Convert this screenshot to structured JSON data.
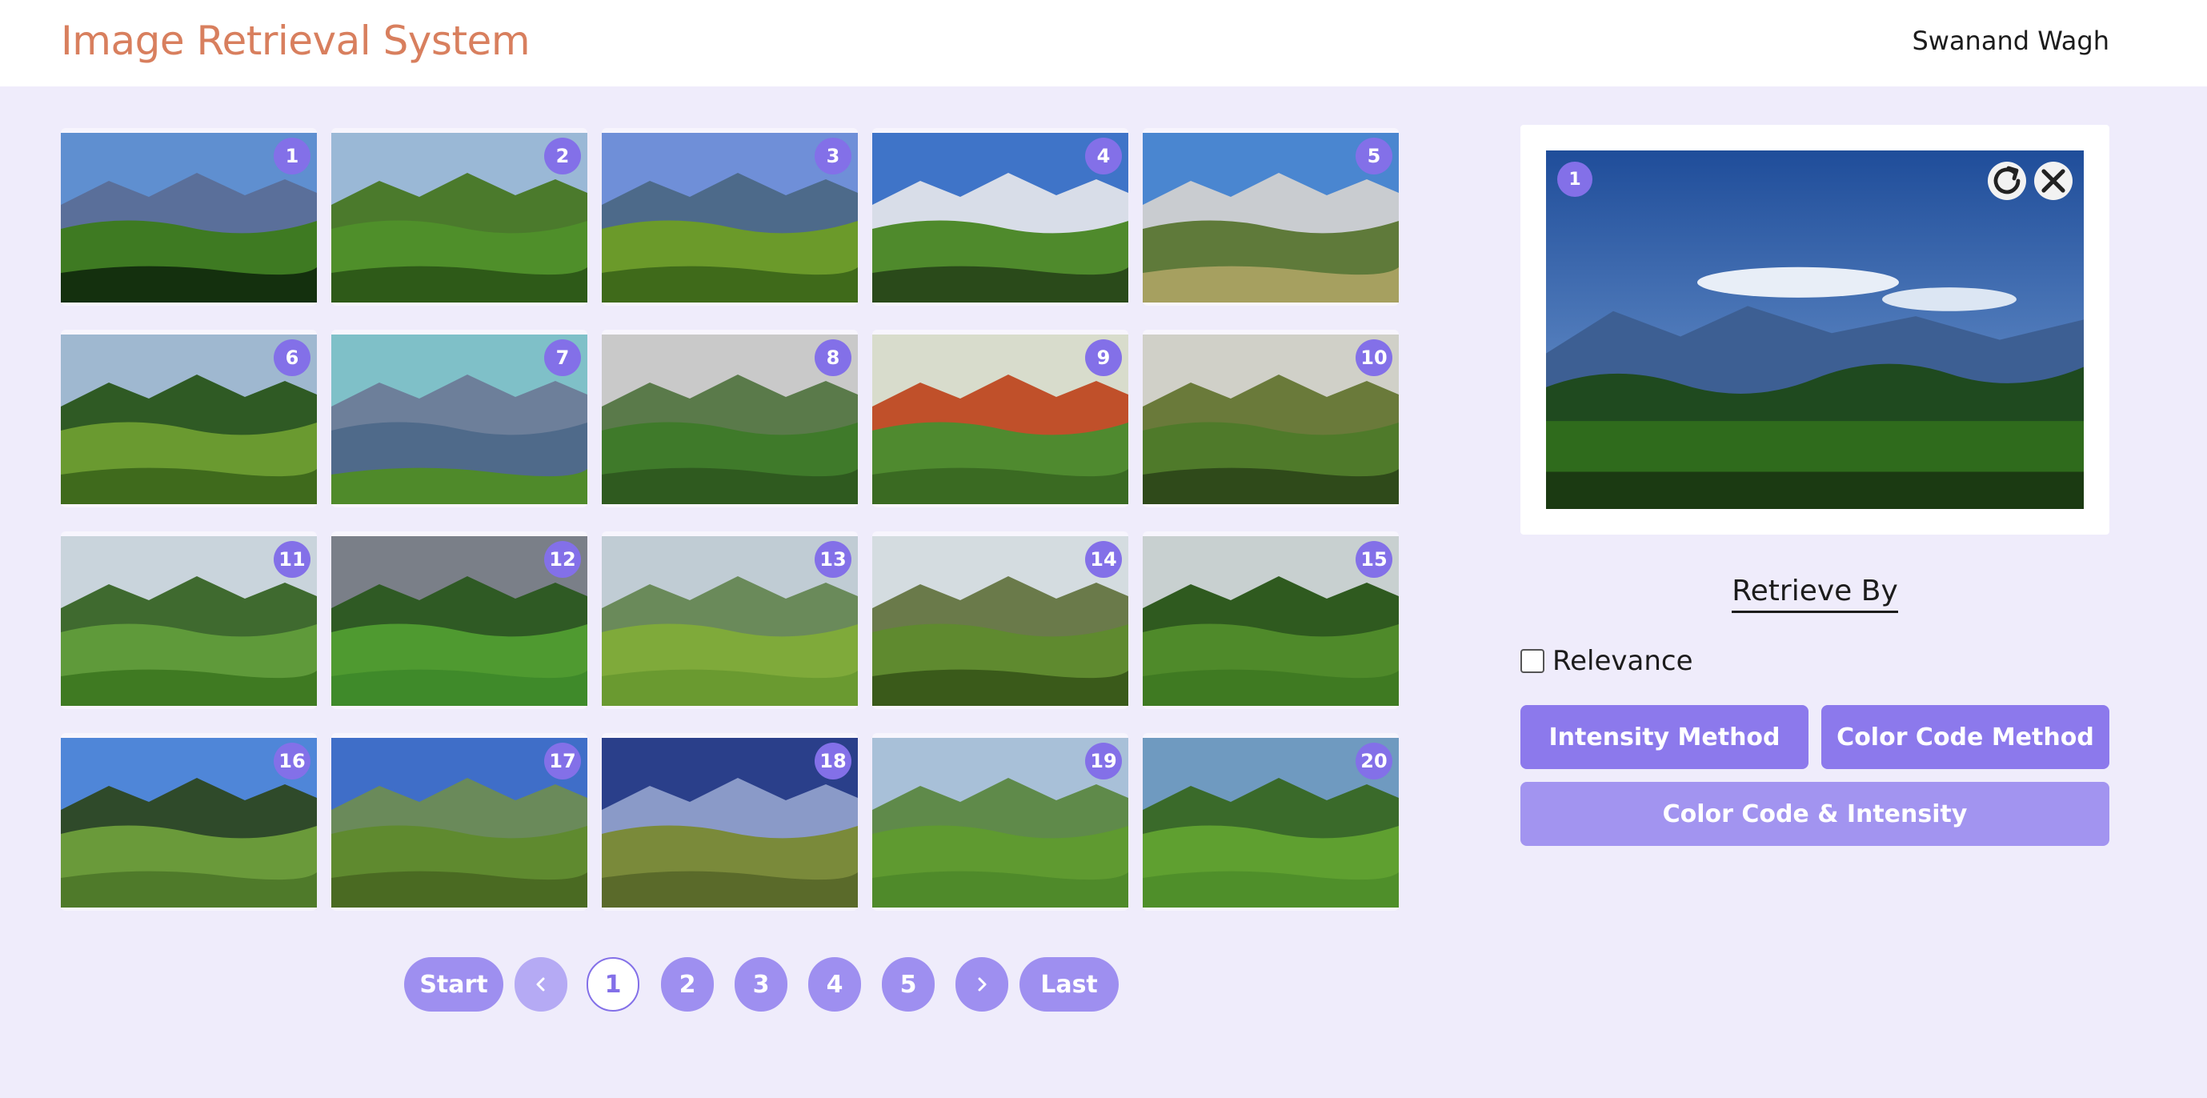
{
  "header": {
    "title": "Image Retrieval System",
    "user": "Swanand Wagh"
  },
  "gallery": {
    "images": [
      {
        "label": "1"
      },
      {
        "label": "2"
      },
      {
        "label": "3"
      },
      {
        "label": "4"
      },
      {
        "label": "5"
      },
      {
        "label": "6"
      },
      {
        "label": "7"
      },
      {
        "label": "8"
      },
      {
        "label": "9"
      },
      {
        "label": "10"
      },
      {
        "label": "11"
      },
      {
        "label": "12"
      },
      {
        "label": "13"
      },
      {
        "label": "14"
      },
      {
        "label": "15"
      },
      {
        "label": "16"
      },
      {
        "label": "17"
      },
      {
        "label": "18"
      },
      {
        "label": "19"
      },
      {
        "label": "20"
      }
    ]
  },
  "pagination": {
    "start": "Start",
    "prev_icon": "chevron-left-icon",
    "pages": [
      "1",
      "2",
      "3",
      "4",
      "5"
    ],
    "current": "1",
    "next_icon": "chevron-right-icon",
    "last": "Last"
  },
  "preview": {
    "label": "1",
    "reset_icon": "refresh-icon",
    "close_icon": "close-icon"
  },
  "retrieve": {
    "title": "Retrieve By",
    "relevance_label": "Relevance",
    "relevance_checked": false,
    "intensity_button": "Intensity Method",
    "color_code_button": "Color Code Method",
    "combined_button": "Color Code & Intensity"
  },
  "colors": {
    "accent": "#8370e8",
    "title": "#d87f5e",
    "background": "#efecfb"
  }
}
